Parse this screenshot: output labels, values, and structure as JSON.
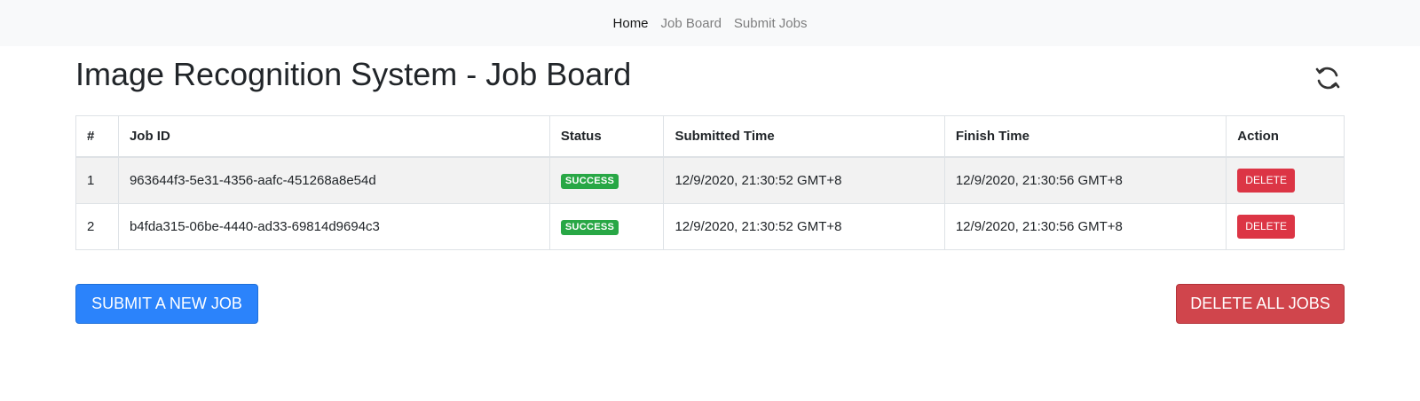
{
  "nav": {
    "items": [
      {
        "label": "Home",
        "active": true
      },
      {
        "label": "Job Board",
        "active": false
      },
      {
        "label": "Submit Jobs",
        "active": false
      }
    ]
  },
  "page": {
    "title": "Image Recognition System - Job Board",
    "refresh_icon": "refresh-icon"
  },
  "table": {
    "headers": [
      "#",
      "Job ID",
      "Status",
      "Submitted Time",
      "Finish Time",
      "Action"
    ],
    "rows": [
      {
        "index": "1",
        "job_id": "963644f3-5e31-4356-aafc-451268a8e54d",
        "status": "SUCCESS",
        "submitted": "12/9/2020, 21:30:52 GMT+8",
        "finished": "12/9/2020, 21:30:56 GMT+8",
        "action": "DELETE"
      },
      {
        "index": "2",
        "job_id": "b4fda315-06be-4440-ad33-69814d9694c3",
        "status": "SUCCESS",
        "submitted": "12/9/2020, 21:30:52 GMT+8",
        "finished": "12/9/2020, 21:30:56 GMT+8",
        "action": "DELETE"
      }
    ]
  },
  "actions": {
    "submit_label": "SUBMIT A NEW JOB",
    "delete_all_label": "DELETE ALL JOBS"
  },
  "colors": {
    "primary": "#2b83fb",
    "danger": "#d0454c",
    "success": "#28a745",
    "navbar_bg": "#f8f9fa"
  }
}
